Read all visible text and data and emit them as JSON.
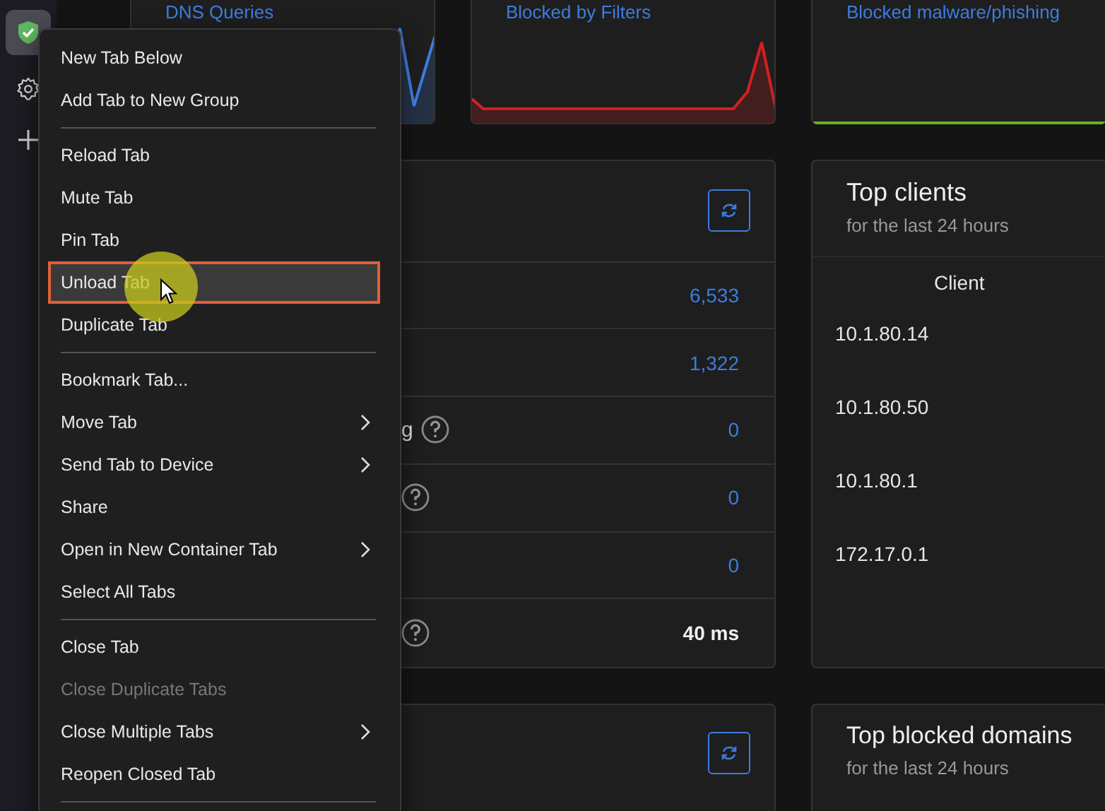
{
  "stat_cards": [
    {
      "title": "DNS Queries",
      "color": "#3b7de0"
    },
    {
      "title": "Blocked by Filters",
      "color": "#d42020"
    },
    {
      "title": "Blocked malware/phishing",
      "color": "#67b21f"
    }
  ],
  "general_stats": {
    "rows": [
      {
        "value": "6,533",
        "link": true,
        "help": false
      },
      {
        "value": "1,322",
        "link": true,
        "help": false
      },
      {
        "label": "g",
        "value": "0",
        "link": true,
        "help": true
      },
      {
        "value": "0",
        "link": true,
        "help": true
      },
      {
        "value": "0",
        "link": true,
        "help": false
      },
      {
        "value": "40 ms",
        "link": false,
        "help": true
      }
    ]
  },
  "top_clients": {
    "title": "Top clients",
    "subtitle": "for the last 24 hours",
    "column": "Client",
    "rows": [
      "10.1.80.14",
      "10.1.80.50",
      "10.1.80.1",
      "172.17.0.1"
    ]
  },
  "top_blocked_domains": {
    "title": "Top blocked domains",
    "subtitle": "for the last 24 hours"
  },
  "context_menu": {
    "items": [
      {
        "kind": "item",
        "label": "New Tab Below",
        "submenu": false,
        "disabled": false,
        "selected": false
      },
      {
        "kind": "item",
        "label": "Add Tab to New Group",
        "submenu": false,
        "disabled": false,
        "selected": false
      },
      {
        "kind": "separator"
      },
      {
        "kind": "item",
        "label": "Reload Tab",
        "submenu": false,
        "disabled": false,
        "selected": false
      },
      {
        "kind": "item",
        "label": "Mute Tab",
        "submenu": false,
        "disabled": false,
        "selected": false
      },
      {
        "kind": "item",
        "label": "Pin Tab",
        "submenu": false,
        "disabled": false,
        "selected": false
      },
      {
        "kind": "item",
        "label": "Unload Tab",
        "submenu": false,
        "disabled": false,
        "selected": true
      },
      {
        "kind": "item",
        "label": "Duplicate Tab",
        "submenu": false,
        "disabled": false,
        "selected": false
      },
      {
        "kind": "separator"
      },
      {
        "kind": "item",
        "label": "Bookmark Tab...",
        "submenu": false,
        "disabled": false,
        "selected": false
      },
      {
        "kind": "item",
        "label": "Move Tab",
        "submenu": true,
        "disabled": false,
        "selected": false
      },
      {
        "kind": "item",
        "label": "Send Tab to Device",
        "submenu": true,
        "disabled": false,
        "selected": false
      },
      {
        "kind": "item",
        "label": "Share",
        "submenu": false,
        "disabled": false,
        "selected": false
      },
      {
        "kind": "item",
        "label": "Open in New Container Tab",
        "submenu": true,
        "disabled": false,
        "selected": false
      },
      {
        "kind": "item",
        "label": "Select All Tabs",
        "submenu": false,
        "disabled": false,
        "selected": false
      },
      {
        "kind": "separator"
      },
      {
        "kind": "item",
        "label": "Close Tab",
        "submenu": false,
        "disabled": false,
        "selected": false
      },
      {
        "kind": "item",
        "label": "Close Duplicate Tabs",
        "submenu": false,
        "disabled": true,
        "selected": false
      },
      {
        "kind": "item",
        "label": "Close Multiple Tabs",
        "submenu": true,
        "disabled": false,
        "selected": false
      },
      {
        "kind": "item",
        "label": "Reopen Closed Tab",
        "submenu": false,
        "disabled": false,
        "selected": false
      },
      {
        "kind": "separator"
      }
    ]
  }
}
